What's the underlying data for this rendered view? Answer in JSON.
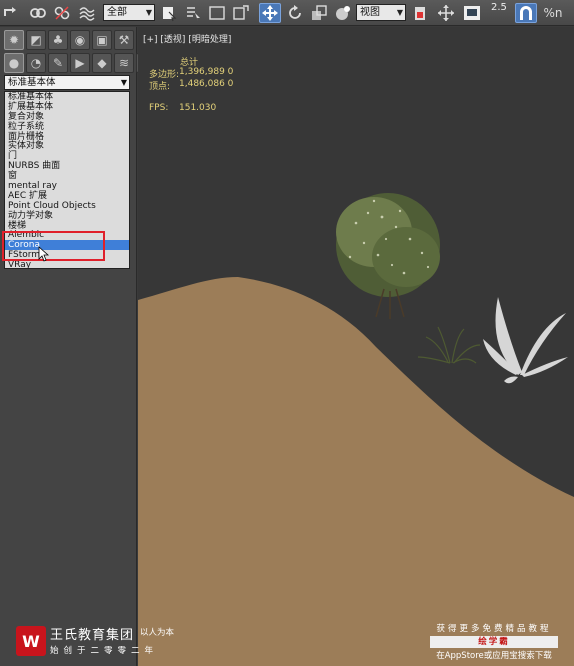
{
  "toolbar": {
    "selection_filter": "全部",
    "reference_coord": "视图",
    "snap_value": "2.5",
    "percent_snap": "%n"
  },
  "command_panel": {
    "category_selected": "标准基本体",
    "categories": [
      "标准基本体",
      "扩展基本体",
      "复合对象",
      "粒子系统",
      "面片栅格",
      "实体对象",
      "门",
      "NURBS 曲面",
      "窗",
      "mental ray",
      "AEC 扩展",
      "Point Cloud Objects",
      "动力学对象",
      "楼梯",
      "Alembic",
      "Corona",
      "FStorm",
      "VRay"
    ],
    "highlighted_item": "Corona"
  },
  "viewport": {
    "label": "[+] [透视] [明暗处理]",
    "stats_header": "总计",
    "polygons_label": "多边形:",
    "polygons_value": "1,396,989  0",
    "vertices_label": "顶点:",
    "vertices_value": "1,486,086  0",
    "fps_label": "FPS:",
    "fps_value": "151.030",
    "colors": {
      "background": "#373737",
      "terrain": "#9c7d58",
      "stats_text": "#e4d27a"
    }
  },
  "watermark_left": {
    "logo_letter": "W",
    "name": "王氏教育集团",
    "motto": "以人为本",
    "slogan": "始创于二零零二年"
  },
  "watermark_right": {
    "line1": "获得更多免费精品教程",
    "badge": "绘学霸",
    "line3": "在AppStore或应用宝搜索下载"
  }
}
